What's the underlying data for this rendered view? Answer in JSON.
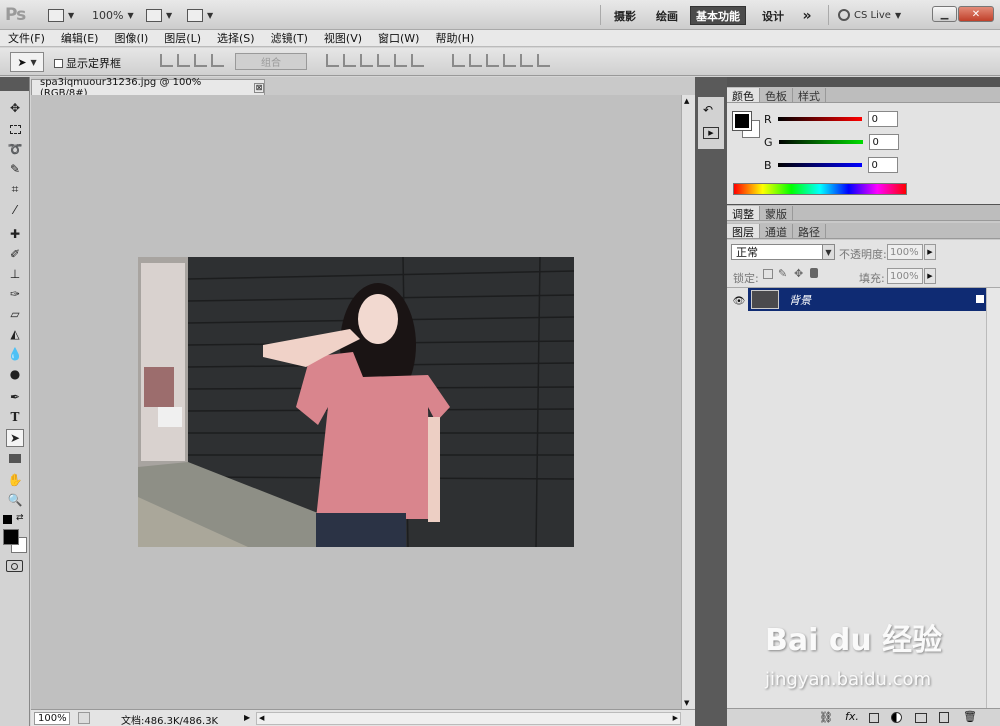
{
  "app": {
    "logo": "Ps",
    "zoom_level": "100%",
    "workspaces": [
      "摄影",
      "绘画",
      "基本功能",
      "设计"
    ],
    "active_workspace": "基本功能",
    "more_label": "»",
    "cs_live_label": "CS Live"
  },
  "menu": [
    "文件(F)",
    "编辑(E)",
    "图像(I)",
    "图层(L)",
    "选择(S)",
    "滤镜(T)",
    "视图(V)",
    "窗口(W)",
    "帮助(H)"
  ],
  "options": {
    "show_bounds_label": "显示定界框",
    "combine_label": "组合"
  },
  "document": {
    "tab_title": "spa3iqmuour31236.jpg @ 100%(RGB/8#)",
    "close_glyph": "⊠",
    "status_zoom": "100%",
    "status_info": "文档:486.3K/486.3K"
  },
  "color_panel": {
    "tabs": [
      "颜色",
      "色板",
      "样式"
    ],
    "r_label": "R",
    "g_label": "G",
    "b_label": "B",
    "r_value": "0",
    "g_value": "0",
    "b_value": "0",
    "foreground_color": "#000000",
    "background_color": "#ffffff"
  },
  "adjust_panel": {
    "tabs": [
      "调整",
      "蒙版"
    ]
  },
  "layers_panel": {
    "tabs": [
      "图层",
      "通道",
      "路径"
    ],
    "blend_mode": "正常",
    "opacity_label": "不透明度:",
    "opacity_value": "100%",
    "lock_label": "锁定:",
    "fill_label": "填充:",
    "fill_value": "100%",
    "layer_name": "背景"
  },
  "watermark": {
    "brand": "Bai du 经验",
    "url": "jingyan.baidu.com"
  }
}
